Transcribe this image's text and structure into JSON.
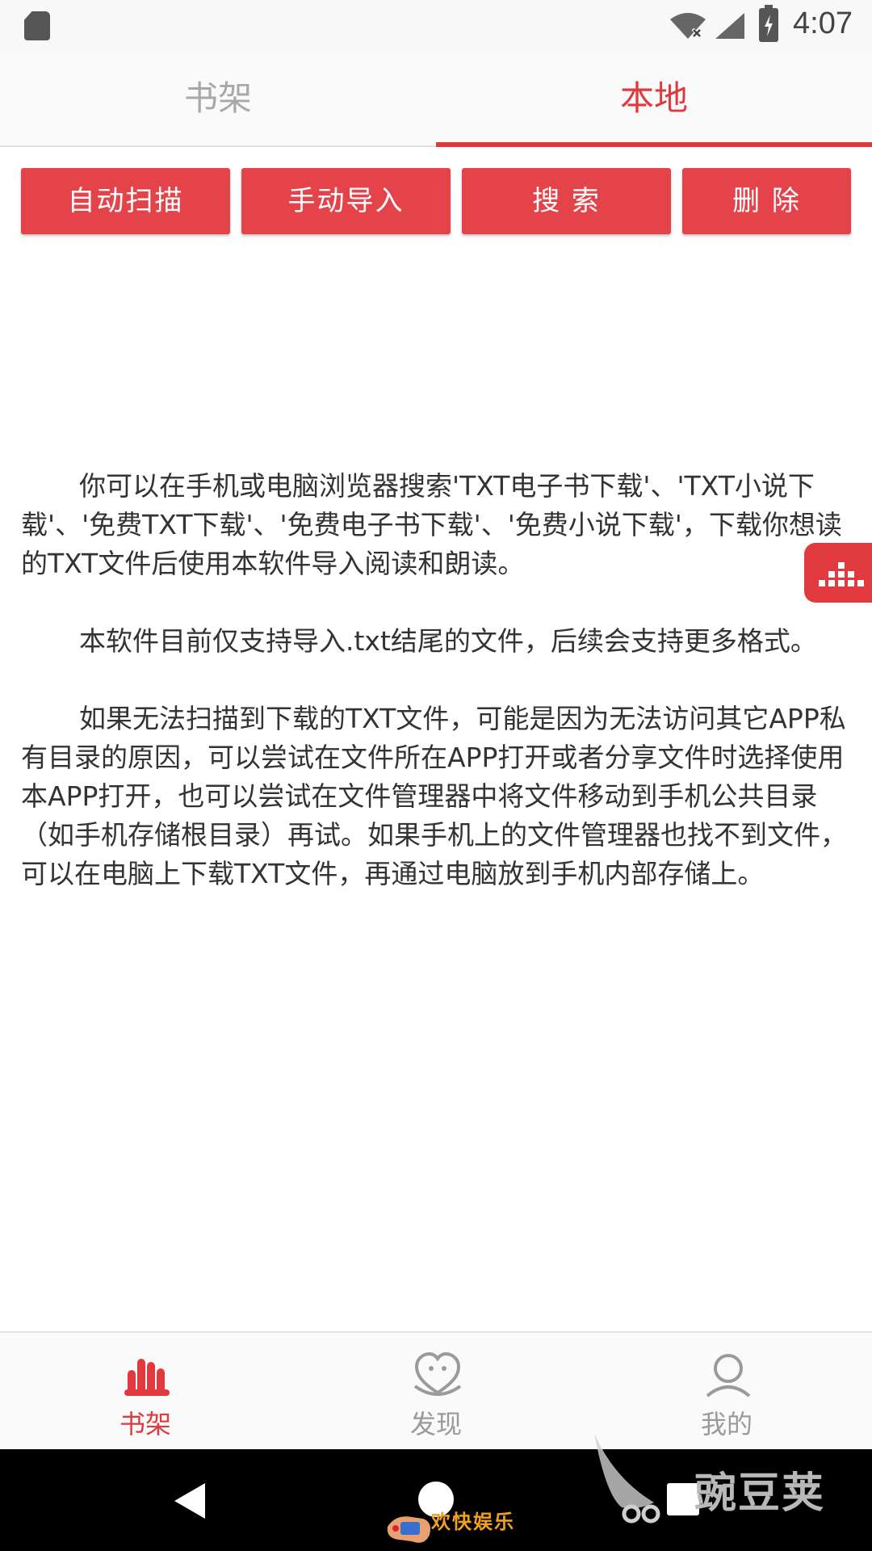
{
  "status_bar": {
    "time": "4:07",
    "icons": [
      "sd-card-icon",
      "wifi-off-icon",
      "signal-icon",
      "battery-charging-icon"
    ]
  },
  "top_tabs": [
    {
      "label": "书架",
      "active": false
    },
    {
      "label": "本地",
      "active": true
    }
  ],
  "actions": {
    "auto_scan": "自动扫描",
    "manual_import": "手动导入",
    "search": "搜 索",
    "delete": "删 除"
  },
  "content": {
    "paragraphs": [
      "你可以在手机或电脑浏览器搜索'TXT电子书下载'、'TXT小说下载'、'免费TXT下载'、'免费电子书下载'、'免费小说下载'，下载你想读的TXT文件后使用本软件导入阅读和朗读。",
      "本软件目前仅支持导入.txt结尾的文件，后续会支持更多格式。",
      "如果无法扫描到下载的TXT文件，可能是因为无法访问其它APP私有目录的原因，可以尝试在文件所在APP打开或者分享文件时选择使用本APP打开，也可以尝试在文件管理器中将文件移动到手机公共目录（如手机存储根目录）再试。如果手机上的文件管理器也找不到文件，可以在电脑上下载TXT文件，再通过电脑放到手机内部存储上。"
    ]
  },
  "bottom_nav": [
    {
      "label": "书架",
      "icon": "bookshelf-icon",
      "active": true
    },
    {
      "label": "发现",
      "icon": "discover-heart-icon",
      "active": false
    },
    {
      "label": "我的",
      "icon": "profile-icon",
      "active": false
    }
  ],
  "watermarks": {
    "left": "欢快娱乐",
    "right": "豌豆荚"
  },
  "colors": {
    "accent": "#e0393e",
    "button": "#e5434a",
    "inactive": "#a8a8a8"
  }
}
